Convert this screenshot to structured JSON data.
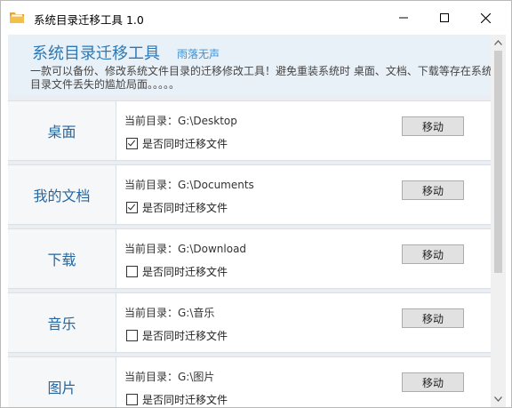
{
  "window": {
    "title": "系统目录迁移工具 1.0"
  },
  "header": {
    "app_name": "系统目录迁移工具",
    "author": "雨落无声",
    "description": "一款可以备份、修改系统文件目录的迁移修改工具！避免重装系统时 桌面、文档、下载等存在系统盘目录文件丢失的尴尬局面。。。。。"
  },
  "rows": [
    {
      "label": "桌面",
      "path": "当前目录：G:\\Desktop",
      "checkbox_label": "是否同时迁移文件",
      "checked": true,
      "button": "移动"
    },
    {
      "label": "我的文档",
      "path": "当前目录：G:\\Documents",
      "checkbox_label": "是否同时迁移文件",
      "checked": true,
      "button": "移动"
    },
    {
      "label": "下载",
      "path": "当前目录：G:\\Download",
      "checkbox_label": "是否同时迁移文件",
      "checked": false,
      "button": "移动"
    },
    {
      "label": "音乐",
      "path": "当前目录：G:\\音乐",
      "checkbox_label": "是否同时迁移文件",
      "checked": false,
      "button": "移动"
    },
    {
      "label": "图片",
      "path": "当前目录：G:\\图片",
      "checkbox_label": "是否同时迁移文件",
      "checked": false,
      "button": "移动"
    }
  ],
  "colors": {
    "accent": "#2e78b4",
    "header_bg": "#e9f1f8",
    "row_label": "#2767a0"
  },
  "icons": {
    "app": "folder-icon",
    "minimize": "minimize-icon",
    "maximize": "maximize-icon",
    "close": "close-icon"
  }
}
